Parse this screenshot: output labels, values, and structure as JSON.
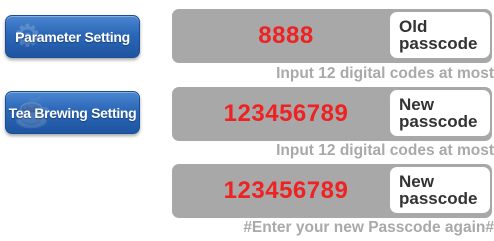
{
  "sidebar": {
    "parameter_setting": "Parameter Setting",
    "tea_brewing_setting": "Tea Brewing Setting"
  },
  "old_passcode": {
    "value": "8888",
    "label": "Old\npasscode",
    "hint": "Input 12 digital codes at most"
  },
  "new_passcode": {
    "value": "123456789",
    "label": "New\npasscode",
    "hint": "Input 12 digital codes at most"
  },
  "confirm_passcode": {
    "value": "123456789",
    "label": "New\npasscode",
    "hint": "#Enter your new Passcode again#"
  },
  "colors": {
    "button_blue": "#2b67b7",
    "bar_gray": "#a8a8a8",
    "value_red": "#ee2222",
    "hint_gray": "#a9a9a9"
  }
}
